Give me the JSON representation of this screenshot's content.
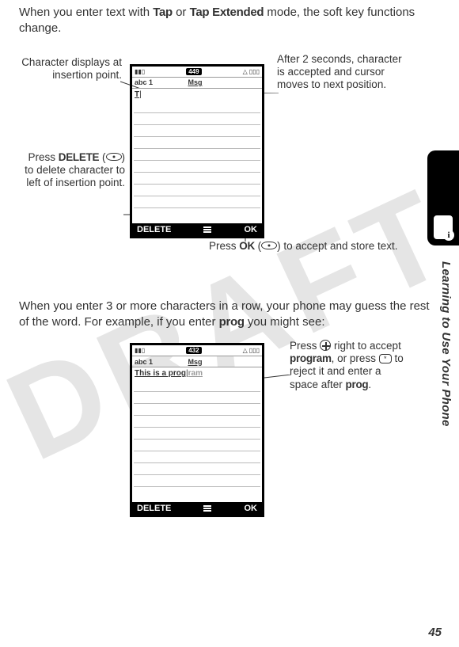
{
  "intro": {
    "pre": "When you enter text with ",
    "tap": "Tap",
    "mid": " or ",
    "tapext": "Tap Extended",
    "post": " mode, the soft key functions change."
  },
  "phone1": {
    "badge": "449",
    "mode": "abc 1",
    "title": "Msg",
    "typed": "T",
    "soft_left": "DELETE",
    "soft_right": "OK"
  },
  "callouts1": {
    "left_top": "Character displays at insertion point.",
    "left_mid_a": "Press ",
    "left_mid_delete": "DELETE",
    "left_mid_b": " (",
    "left_mid_c": ") to delete character to left of insertion point.",
    "right_top": "After 2 seconds, character is accepted and cursor moves to next position.",
    "bottom_a": "Press ",
    "bottom_ok": "OK",
    "bottom_b": " (",
    "bottom_c": ") to accept and store text."
  },
  "middle": {
    "line1": "When you enter 3 or more characters in a row, your phone may guess the rest of the word. For example, if you enter ",
    "prog": "prog",
    "line2": " you might see:"
  },
  "phone2": {
    "badge": "432",
    "mode": "abc 1",
    "title": "Msg",
    "typed": "This is a prog",
    "suggest": "ram",
    "soft_left": "DELETE",
    "soft_right": "OK"
  },
  "callouts2": {
    "a": "Press ",
    "b": " right to accept ",
    "program": "program",
    "c": ", or press ",
    "d": " to reject it and enter a space after ",
    "prog": "prog",
    "e": "."
  },
  "side_label": "Learning to Use Your Phone",
  "page_number": "45"
}
